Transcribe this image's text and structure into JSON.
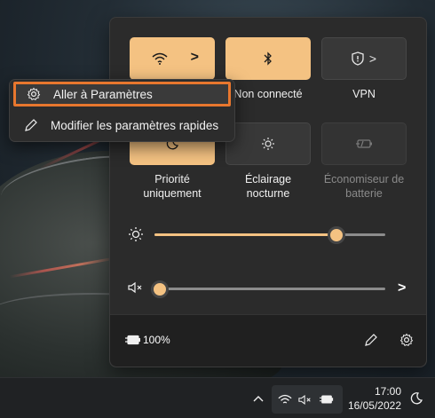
{
  "quick_settings": {
    "tiles_row1": [
      {
        "id": "wifi",
        "label": "",
        "icon": "wifi-icon",
        "state": "on",
        "chevron": ">"
      },
      {
        "id": "bluetooth",
        "label": "Non connecté",
        "icon": "bluetooth-icon",
        "state": "on"
      },
      {
        "id": "vpn",
        "label": "VPN",
        "icon": "shield-icon",
        "state": "off",
        "chevron": ">"
      }
    ],
    "tiles_row2": [
      {
        "id": "focus",
        "label_line1": "Priorité",
        "label_line2": "uniquement",
        "icon": "moon-icon",
        "state": "on"
      },
      {
        "id": "night_light",
        "label_line1": "Éclairage",
        "label_line2": "nocturne",
        "icon": "night-light-icon",
        "state": "off"
      },
      {
        "id": "battery_saver",
        "label_line1": "Économiseur de",
        "label_line2": "batterie",
        "icon": "battery-saver-icon",
        "state": "disabled"
      }
    ],
    "brightness": {
      "icon": "sun-icon",
      "value": 0.79
    },
    "volume": {
      "icon": "speaker-muted-icon",
      "value": 0.0,
      "chevron": ">"
    },
    "footer": {
      "battery_text": "100%",
      "battery_icon": "battery-charging-icon",
      "edit_icon": "pencil-icon",
      "settings_icon": "gear-icon"
    }
  },
  "context_menu": {
    "items": [
      {
        "label": "Aller à Paramètres",
        "icon": "gear-icon",
        "highlighted": true
      },
      {
        "label": "Modifier les paramètres rapides",
        "icon": "pencil-icon",
        "highlighted": false
      }
    ]
  },
  "taskbar": {
    "tray_icons": [
      "chevron-up-icon",
      "wifi-icon",
      "speaker-muted-icon",
      "battery-charging-icon"
    ],
    "time": "17:00",
    "date": "16/05/2022",
    "focus_icon": "moon-icon"
  },
  "colors": {
    "accent": "#f4c282",
    "highlight_border": "#e8772e",
    "panel": "#2b2b2b"
  }
}
